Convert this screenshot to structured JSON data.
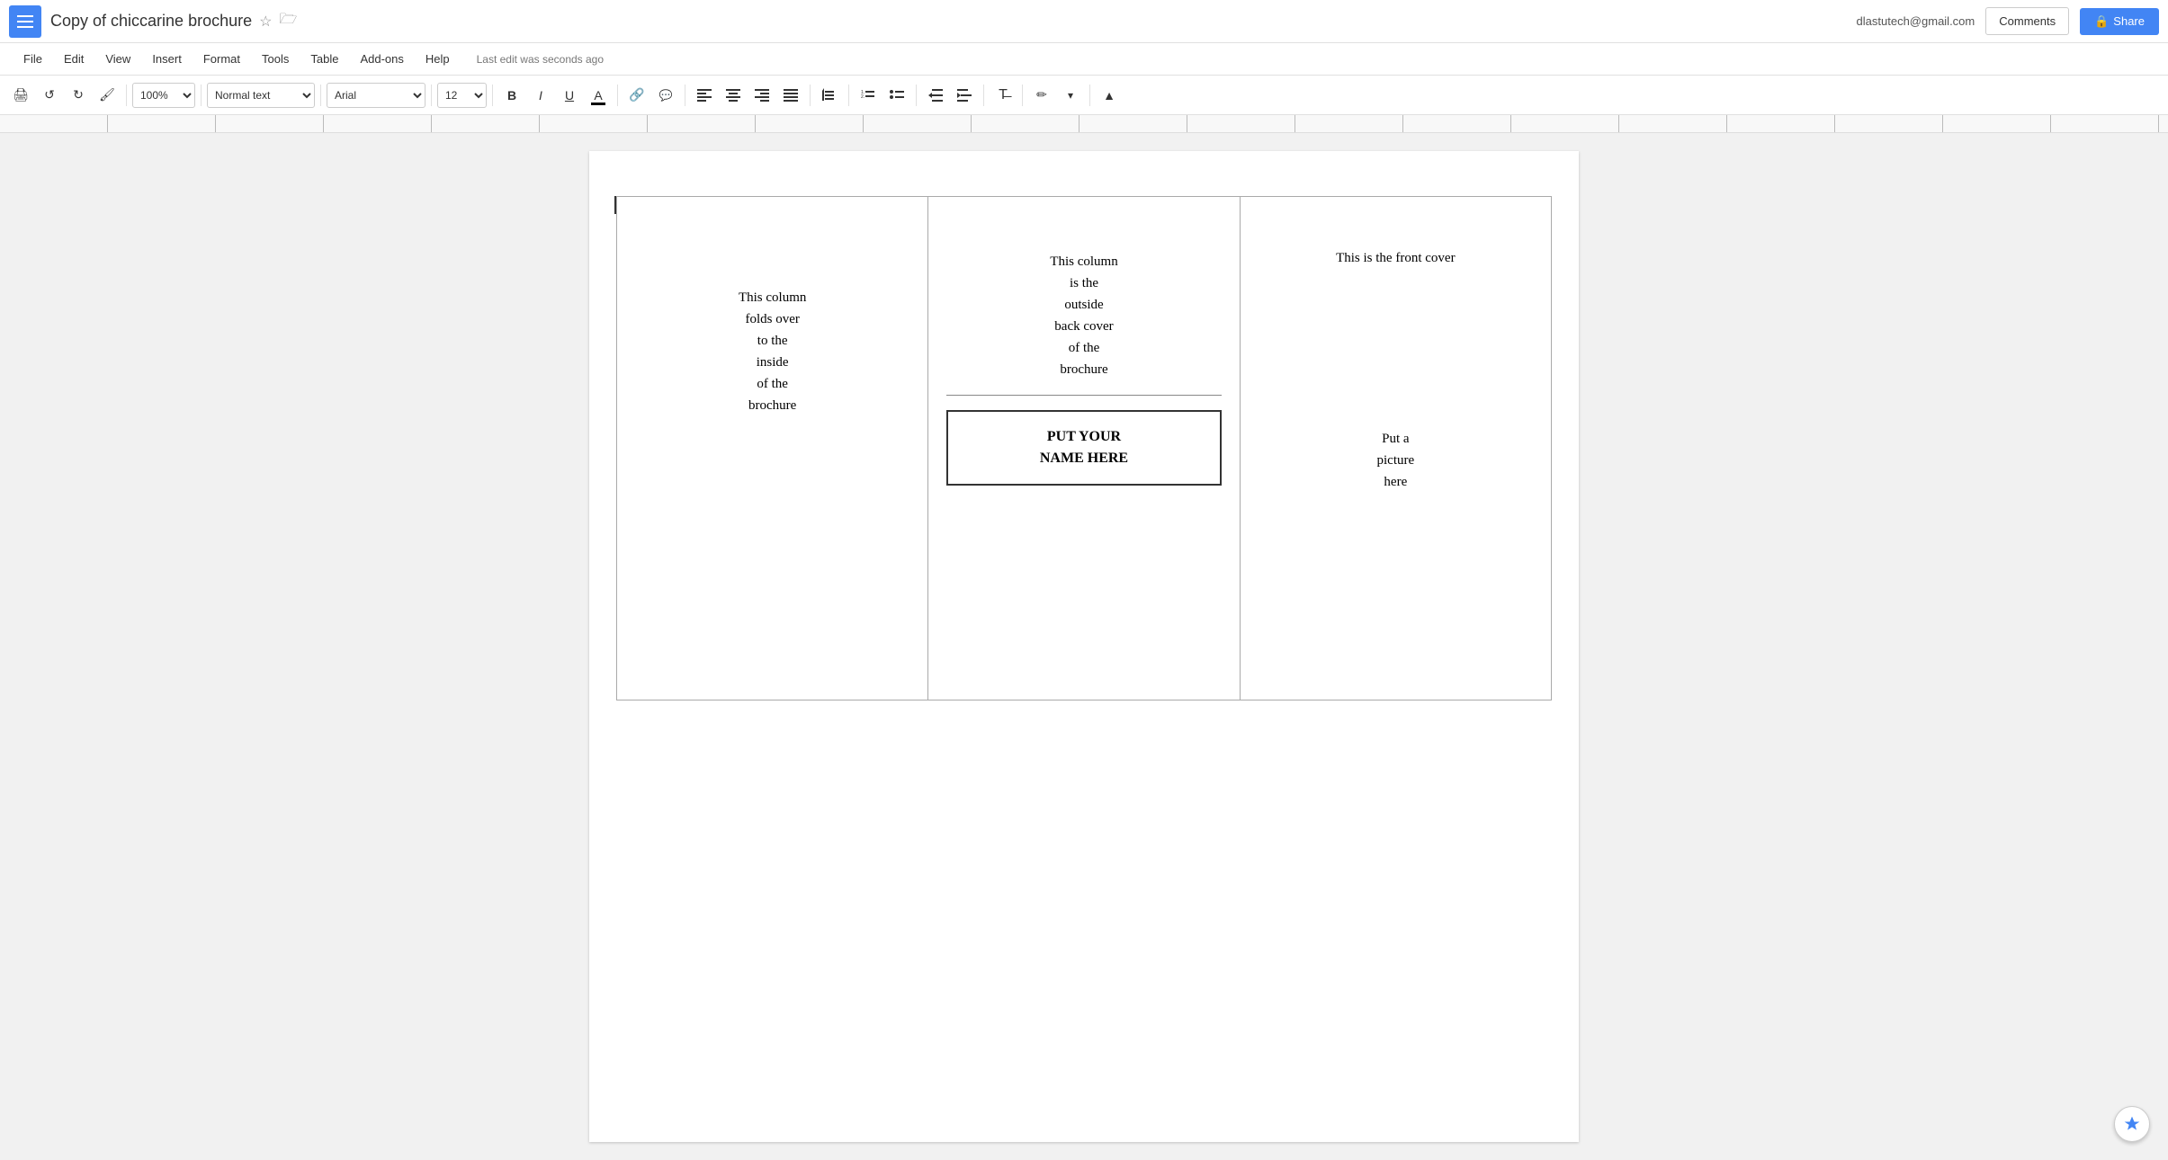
{
  "topbar": {
    "app_btn_label": "☰",
    "doc_title": "Copy of chiccarine brochure",
    "star": "☆",
    "folder": "🗁",
    "user_email": "dlastutech@gmail.com",
    "comments_label": "Comments",
    "share_label": "Share",
    "share_icon": "🔒"
  },
  "menubar": {
    "items": [
      "File",
      "Edit",
      "View",
      "Insert",
      "Format",
      "Tools",
      "Table",
      "Add-ons",
      "Help"
    ],
    "last_edit": "Last edit was seconds ago"
  },
  "toolbar": {
    "print_icon": "🖨",
    "undo_icon": "↺",
    "redo_icon": "↻",
    "paintformat_icon": "🖌",
    "zoom_value": "100%",
    "style_value": "Normal text",
    "font_value": "Arial",
    "size_value": "12",
    "bold_label": "B",
    "italic_label": "I",
    "underline_label": "U",
    "fontcolor_label": "A",
    "link_icon": "🔗",
    "comment_icon": "💬",
    "align_left": "≡",
    "align_center": "≡",
    "align_right": "≡",
    "align_justify": "≡",
    "linespacing_icon": "↕",
    "numberedlist_icon": "≡",
    "bulletlist_icon": "≡",
    "indent_decrease": "←",
    "indent_increase": "→",
    "clear_format": "✗",
    "pencil_icon": "✏",
    "collapse_icon": "▲"
  },
  "document": {
    "col1": {
      "text": "This column\nfolds over\nto the\ninside\nof the\nbrochure"
    },
    "col2": {
      "top_text": "This column\nis the\noutside\nback cover\nof the\nbrochure",
      "name_box_line1": "PUT YOUR",
      "name_box_line2": "NAME HERE"
    },
    "col3": {
      "top_text": "This is the front cover",
      "picture_text": "Put a\npicture\nhere"
    }
  }
}
